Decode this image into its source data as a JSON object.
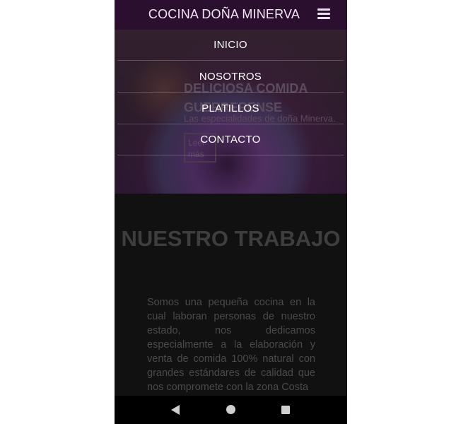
{
  "header": {
    "brand": "COCINA DOÑA MINERVA",
    "menu_icon": "hamburger-menu-icon"
  },
  "menu": {
    "items": [
      {
        "label": "INICIO"
      },
      {
        "label": "NOSOTROS"
      },
      {
        "label": "PLATILLOS"
      },
      {
        "label": "CONTACTO"
      }
    ]
  },
  "hero": {
    "title": "DELICIOSA COMIDA GUERRERENSE",
    "subtitle": "Las especialidades de doña Minerva.",
    "button_label": "Leer más"
  },
  "section": {
    "title": "NUESTRO TRABAJO",
    "text": "Somos una pequeña cocina en la cual laboran personas de nuestro estado, nos dedicamos especialmente a la elaboración y venta de comida 100% natural con grandes estándares de calidad que nos compromete con la zona Costa"
  },
  "navbar": {
    "back_icon": "back-triangle-icon",
    "home_icon": "home-circle-icon",
    "recent_icon": "recent-apps-square-icon"
  },
  "colors": {
    "header_bg": "#2b0f2e",
    "page_bg": "#111111",
    "menu_text": "#ffffff"
  }
}
